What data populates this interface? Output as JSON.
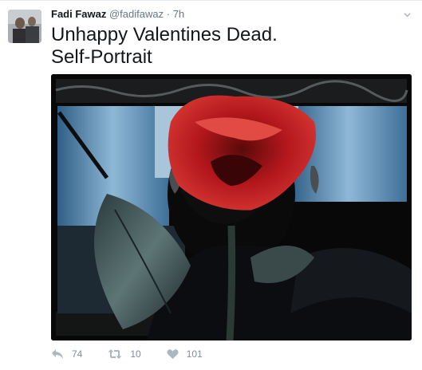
{
  "tweet": {
    "author_name": "Fadi Fawaz",
    "handle": "@fadifawaz",
    "separator": "·",
    "time": "7h",
    "text_line1": "Unhappy Valentines Dead.",
    "text_line2": "Self-Portrait"
  },
  "actions": {
    "reply_count": "74",
    "retweet_count": "10",
    "like_count": "101"
  },
  "icons": {
    "more": "chevron-down-icon",
    "reply": "reply-icon",
    "retweet": "retweet-icon",
    "like": "heart-icon"
  },
  "colors": {
    "text": "#14171a",
    "secondary": "#657786",
    "action": "#aab8c2"
  }
}
